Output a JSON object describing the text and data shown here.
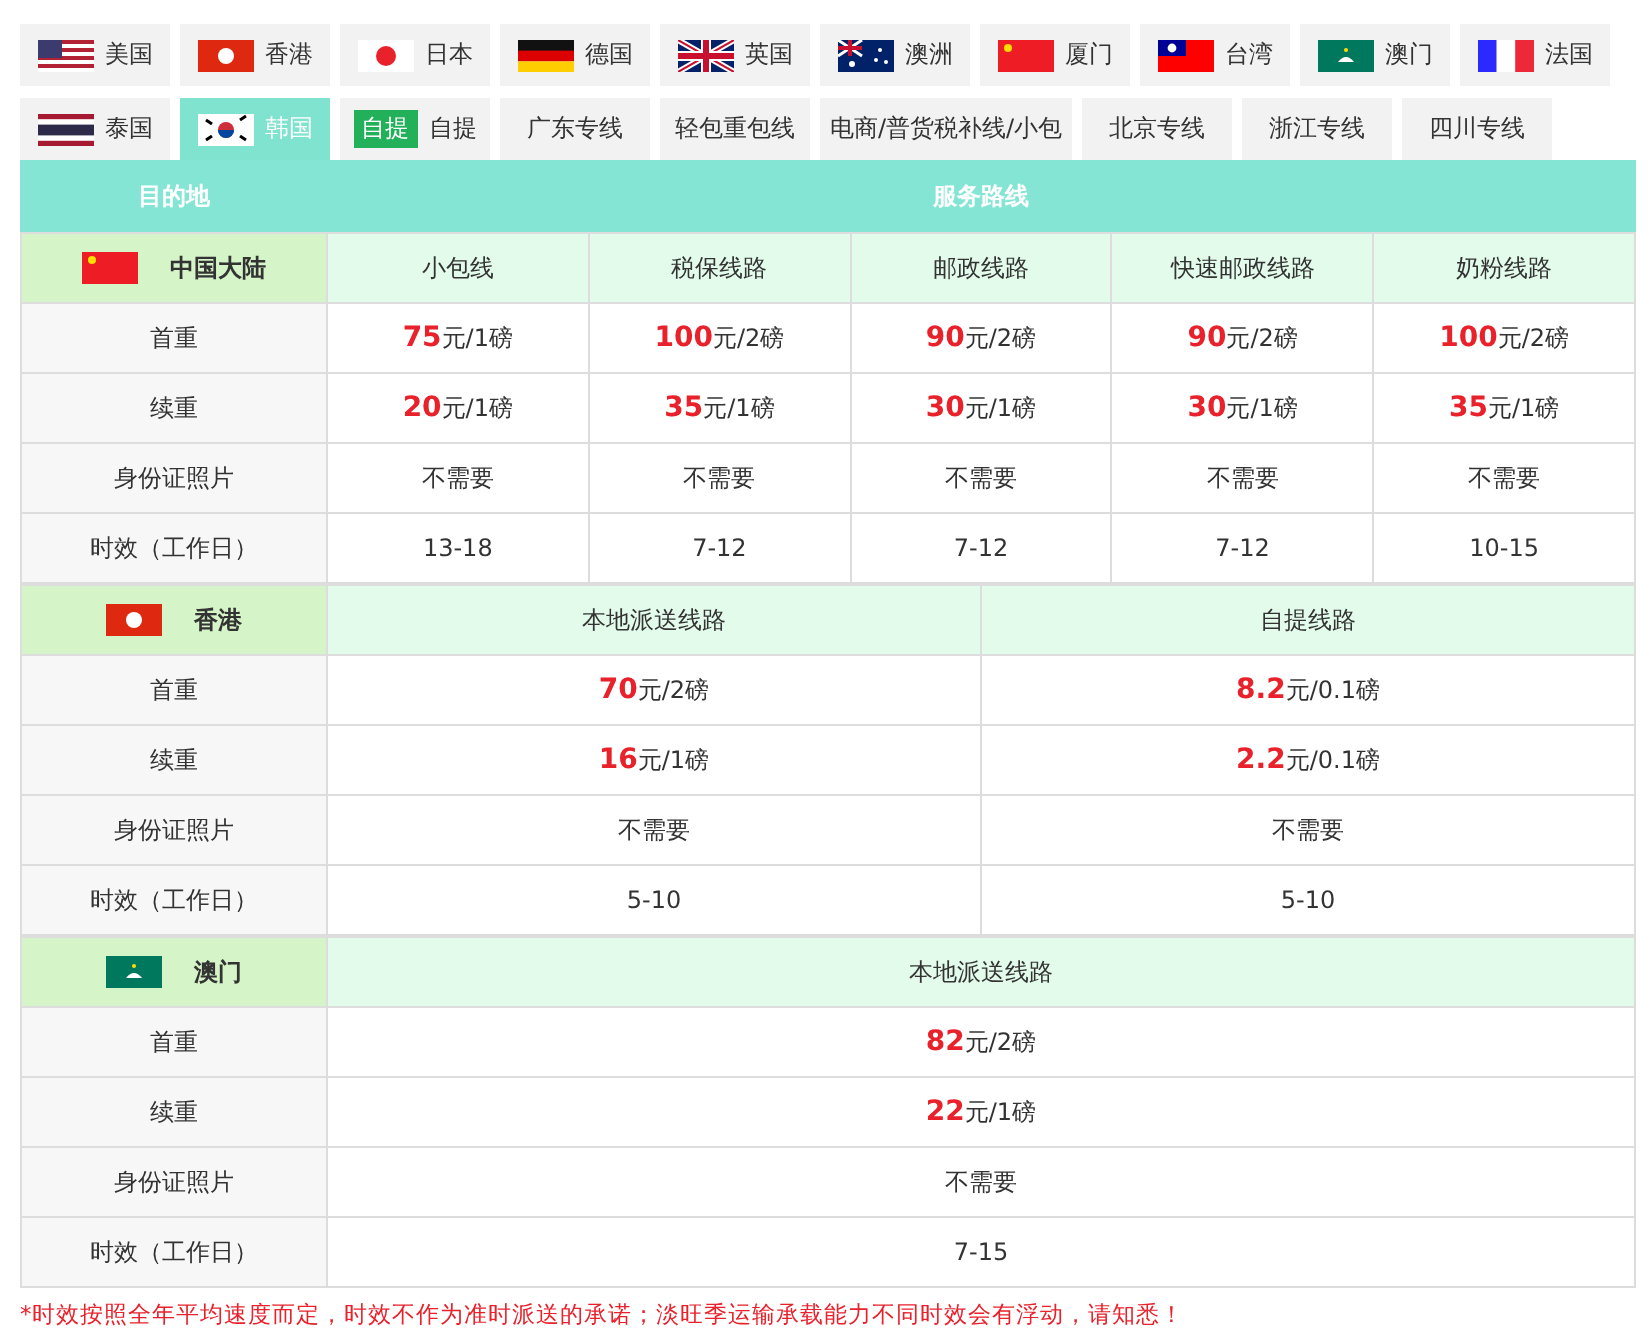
{
  "tabs": [
    {
      "label": "美国",
      "kind": "flag",
      "selected": false
    },
    {
      "label": "香港",
      "kind": "flag",
      "selected": false
    },
    {
      "label": "日本",
      "kind": "flag",
      "selected": false
    },
    {
      "label": "德国",
      "kind": "flag",
      "selected": false
    },
    {
      "label": "英国",
      "kind": "flag",
      "selected": false
    },
    {
      "label": "澳洲",
      "kind": "flag",
      "selected": false
    },
    {
      "label": "厦门",
      "kind": "flag",
      "selected": false
    },
    {
      "label": "台湾",
      "kind": "flag",
      "selected": false
    },
    {
      "label": "澳门",
      "kind": "flag",
      "selected": false
    },
    {
      "label": "法国",
      "kind": "flag",
      "selected": false
    },
    {
      "label": "泰国",
      "kind": "flag",
      "selected": false
    },
    {
      "label": "韩国",
      "kind": "flag",
      "selected": true
    },
    {
      "label": "自提",
      "kind": "badge",
      "badge": "自提",
      "selected": false
    },
    {
      "label": "广东专线",
      "kind": "plain",
      "selected": false
    },
    {
      "label": "轻包重包线",
      "kind": "plain",
      "selected": false
    },
    {
      "label": "电商/普货税补线/小包",
      "kind": "plain",
      "selected": false
    },
    {
      "label": "北京专线",
      "kind": "plain",
      "selected": false
    },
    {
      "label": "浙江专线",
      "kind": "plain",
      "selected": false
    },
    {
      "label": "四川专线",
      "kind": "plain",
      "selected": false
    }
  ],
  "table": {
    "columns": [
      "目的地",
      "服务路线"
    ],
    "sections": [
      {
        "region": "中国大陆",
        "routes": [
          "小包线",
          "税保线路",
          "邮政线路",
          "快速邮政线路",
          "奶粉线路"
        ],
        "rows": [
          {
            "label": "首重",
            "cells": [
              "**75**元/1磅",
              "**100**元/2磅",
              "**90**元/2磅",
              "**90**元/2磅",
              "**100**元/2磅"
            ]
          },
          {
            "label": "续重",
            "cells": [
              "**20**元/1磅",
              "**35**元/1磅",
              "**30**元/1磅",
              "**30**元/1磅",
              "**35**元/1磅"
            ]
          },
          {
            "label": "身份证照片",
            "cells": [
              "不需要",
              "不需要",
              "不需要",
              "不需要",
              "不需要"
            ]
          },
          {
            "label": "时效（工作日）",
            "cells": [
              "13-18",
              "7-12",
              "7-12",
              "7-12",
              "10-15"
            ]
          }
        ]
      },
      {
        "region": "香港",
        "routes": [
          "本地派送线路",
          "自提线路"
        ],
        "rows": [
          {
            "label": "首重",
            "cells": [
              "**70**元/2磅",
              "**8.2**元/0.1磅"
            ]
          },
          {
            "label": "续重",
            "cells": [
              "**16**元/1磅",
              "**2.2**元/0.1磅"
            ]
          },
          {
            "label": "身份证照片",
            "cells": [
              "不需要",
              "不需要"
            ]
          },
          {
            "label": "时效（工作日）",
            "cells": [
              "5-10",
              "5-10"
            ]
          }
        ]
      },
      {
        "region": "澳门",
        "routes": [
          "本地派送线路"
        ],
        "rows": [
          {
            "label": "首重",
            "cells": [
              "**82**元/2磅"
            ]
          },
          {
            "label": "续重",
            "cells": [
              "**22**元/1磅"
            ]
          },
          {
            "label": "身份证照片",
            "cells": [
              "不需要"
            ]
          },
          {
            "label": "时效（工作日）",
            "cells": [
              "7-15"
            ]
          }
        ]
      }
    ]
  },
  "note": "*时效按照全年平均速度而定，时效不作为准时派送的承诺；淡旺季运输承载能力不同时效会有浮动，请知悉！"
}
